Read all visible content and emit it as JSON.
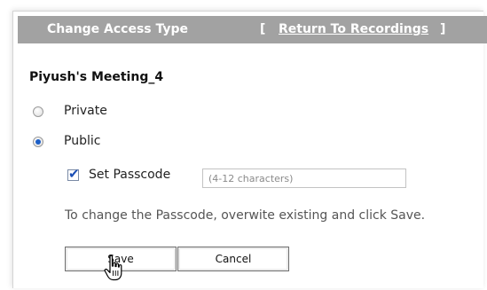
{
  "header": {
    "title": "Change Access Type",
    "bracket_open": "[",
    "return_link": "Return To Recordings",
    "bracket_close": "]"
  },
  "meeting": {
    "title": "Piyush's Meeting_4"
  },
  "access": {
    "private_label": "Private",
    "public_label": "Public",
    "selected": "Public"
  },
  "passcode": {
    "checkbox_label": "Set Passcode",
    "checked": true,
    "value": "",
    "placeholder": "(4-12 characters)",
    "hint": "To change the Passcode, overwite existing and click Save."
  },
  "buttons": {
    "save": "Save",
    "cancel": "Cancel"
  },
  "colors": {
    "header_bg": "#a2a2a2",
    "radio_accent": "#1c5fc7",
    "checkbox_accent": "#1b4fb5"
  },
  "icons": {
    "cursor": "hand-pointer-icon"
  }
}
